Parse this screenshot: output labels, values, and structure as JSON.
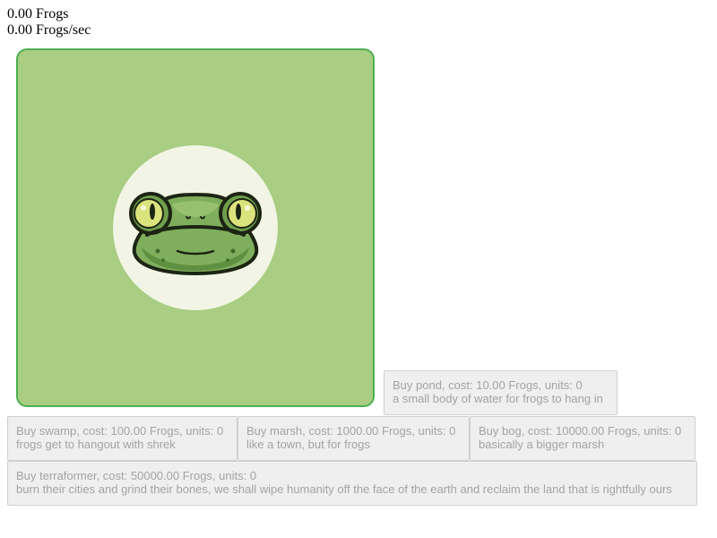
{
  "stats": {
    "frogs": "0.00 Frogs",
    "rate": "0.00 Frogs/sec"
  },
  "clicker": {
    "icon": "frog-face-icon",
    "colors": {
      "panel": "#a9cd83",
      "border": "#4caf50",
      "disc": "#f2f5e5"
    }
  },
  "shop": [
    {
      "title": "Buy pond, cost: 10.00 Frogs, units: 0",
      "description": "a small body of water for frogs to hang in"
    },
    {
      "title": "Buy swamp, cost: 100.00 Frogs, units: 0",
      "description": "frogs get to hangout with shrek"
    },
    {
      "title": "Buy marsh, cost: 1000.00 Frogs, units: 0",
      "description": "like a town, but for frogs"
    },
    {
      "title": "Buy bog, cost: 10000.00 Frogs, units: 0",
      "description": "basically a bigger marsh"
    },
    {
      "title": "Buy terraformer, cost: 50000.00 Frogs, units: 0",
      "description": "burn their cities and grind their bones, we shall wipe humanity off the face of the earth and reclaim the land that is rightfully ours"
    }
  ]
}
